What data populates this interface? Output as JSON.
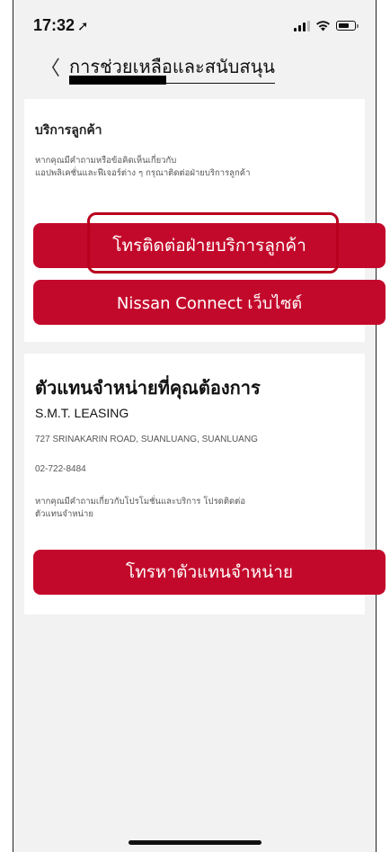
{
  "status_bar": {
    "time": "17:32",
    "location_arrow": "location-arrow-icon"
  },
  "nav": {
    "back_glyph": "〈",
    "title": "การช่วยเหลือและสนับสนุน"
  },
  "customer_service": {
    "heading": "บริการลูกค้า",
    "description_line1": "หากคุณมีคำถามหรือข้อคิดเห็นเกี่ยวกับ",
    "description_line2": "แอปพลิเคชั่นและฟีเจอร์ต่าง ๆ กรุณาติดต่อฝ่ายบริการลูกค้า",
    "call_button": "โทรติดต่อฝ่ายบริการลูกค้า",
    "website_button": "Nissan Connect เว็บไซต์"
  },
  "dealer": {
    "heading": "ตัวแทนจำหน่ายที่คุณต้องการ",
    "name": "S.M.T. LEASING",
    "address": "727 SRINAKARIN ROAD, SUANLUANG, SUANLUANG",
    "phone": "02-722-8484",
    "description_line1": "หากคุณมีคำถามเกี่ยวกับโปรโมชั่นและบริการ โปรดติดต่อ",
    "description_line2": "ตัวแทนจำหน่าย",
    "call_button": "โทรหาตัวแทนจำหน่าย"
  },
  "colors": {
    "accent": "#c3092b",
    "background": "#f2f2f2",
    "card": "#ffffff",
    "highlight": "#b8001e"
  }
}
